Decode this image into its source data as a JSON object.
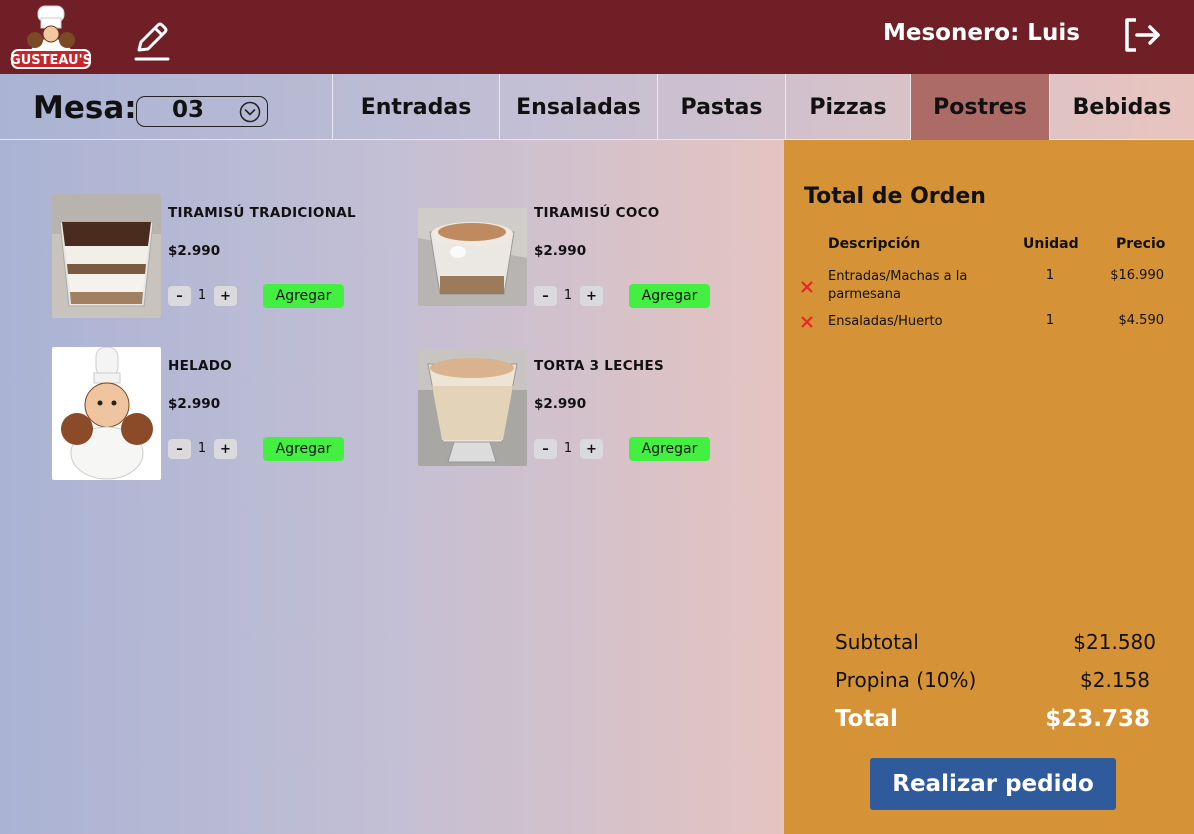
{
  "header": {
    "logo_text": "GUSTEAU'S",
    "waiter": "Mesonero: Luis"
  },
  "mesa": {
    "label": "Mesa:",
    "value": "03"
  },
  "tabs": [
    {
      "label": "Entradas",
      "active": false
    },
    {
      "label": "Ensaladas",
      "active": false
    },
    {
      "label": "Pastas",
      "active": false
    },
    {
      "label": "Pizzas",
      "active": false
    },
    {
      "label": "Postres",
      "active": true
    },
    {
      "label": "Bebidas",
      "active": false
    }
  ],
  "products": [
    {
      "name": "TIRAMISÚ TRADICIONAL",
      "price": "$2.990",
      "qty": "1",
      "add_label": "Agregar"
    },
    {
      "name": "TIRAMISÚ COCO",
      "price": "$2.990",
      "qty": "1",
      "add_label": "Agregar"
    },
    {
      "name": "HELADO",
      "price": "$2.990",
      "qty": "1",
      "add_label": "Agregar"
    },
    {
      "name": "TORTA 3 LECHES",
      "price": "$2.990",
      "qty": "1",
      "add_label": "Agregar"
    }
  ],
  "qty_controls": {
    "minus": "–",
    "plus": "+"
  },
  "order": {
    "title": "Total de Orden",
    "columns": {
      "desc": "Descripción",
      "unit": "Unidad",
      "price": "Precio"
    },
    "items": [
      {
        "desc": "Entradas/Machas a la parmesana",
        "unit": "1",
        "price": "$16.990"
      },
      {
        "desc": "Ensaladas/Huerto",
        "unit": "1",
        "price": "$4.590"
      }
    ],
    "subtotal_label": "Subtotal",
    "subtotal": "$21.580",
    "tip_label": "Propina (10%)",
    "tip": "$2.158",
    "total_label": "Total",
    "total": "$23.738",
    "submit_label": "Realizar pedido"
  },
  "colors": {
    "header": "#711f26",
    "active_tab": "#ad6b68",
    "order_panel": "#d59236",
    "add_button": "#43f041",
    "submit_button": "#2f5b9c",
    "remove_x": "#e8262a"
  }
}
